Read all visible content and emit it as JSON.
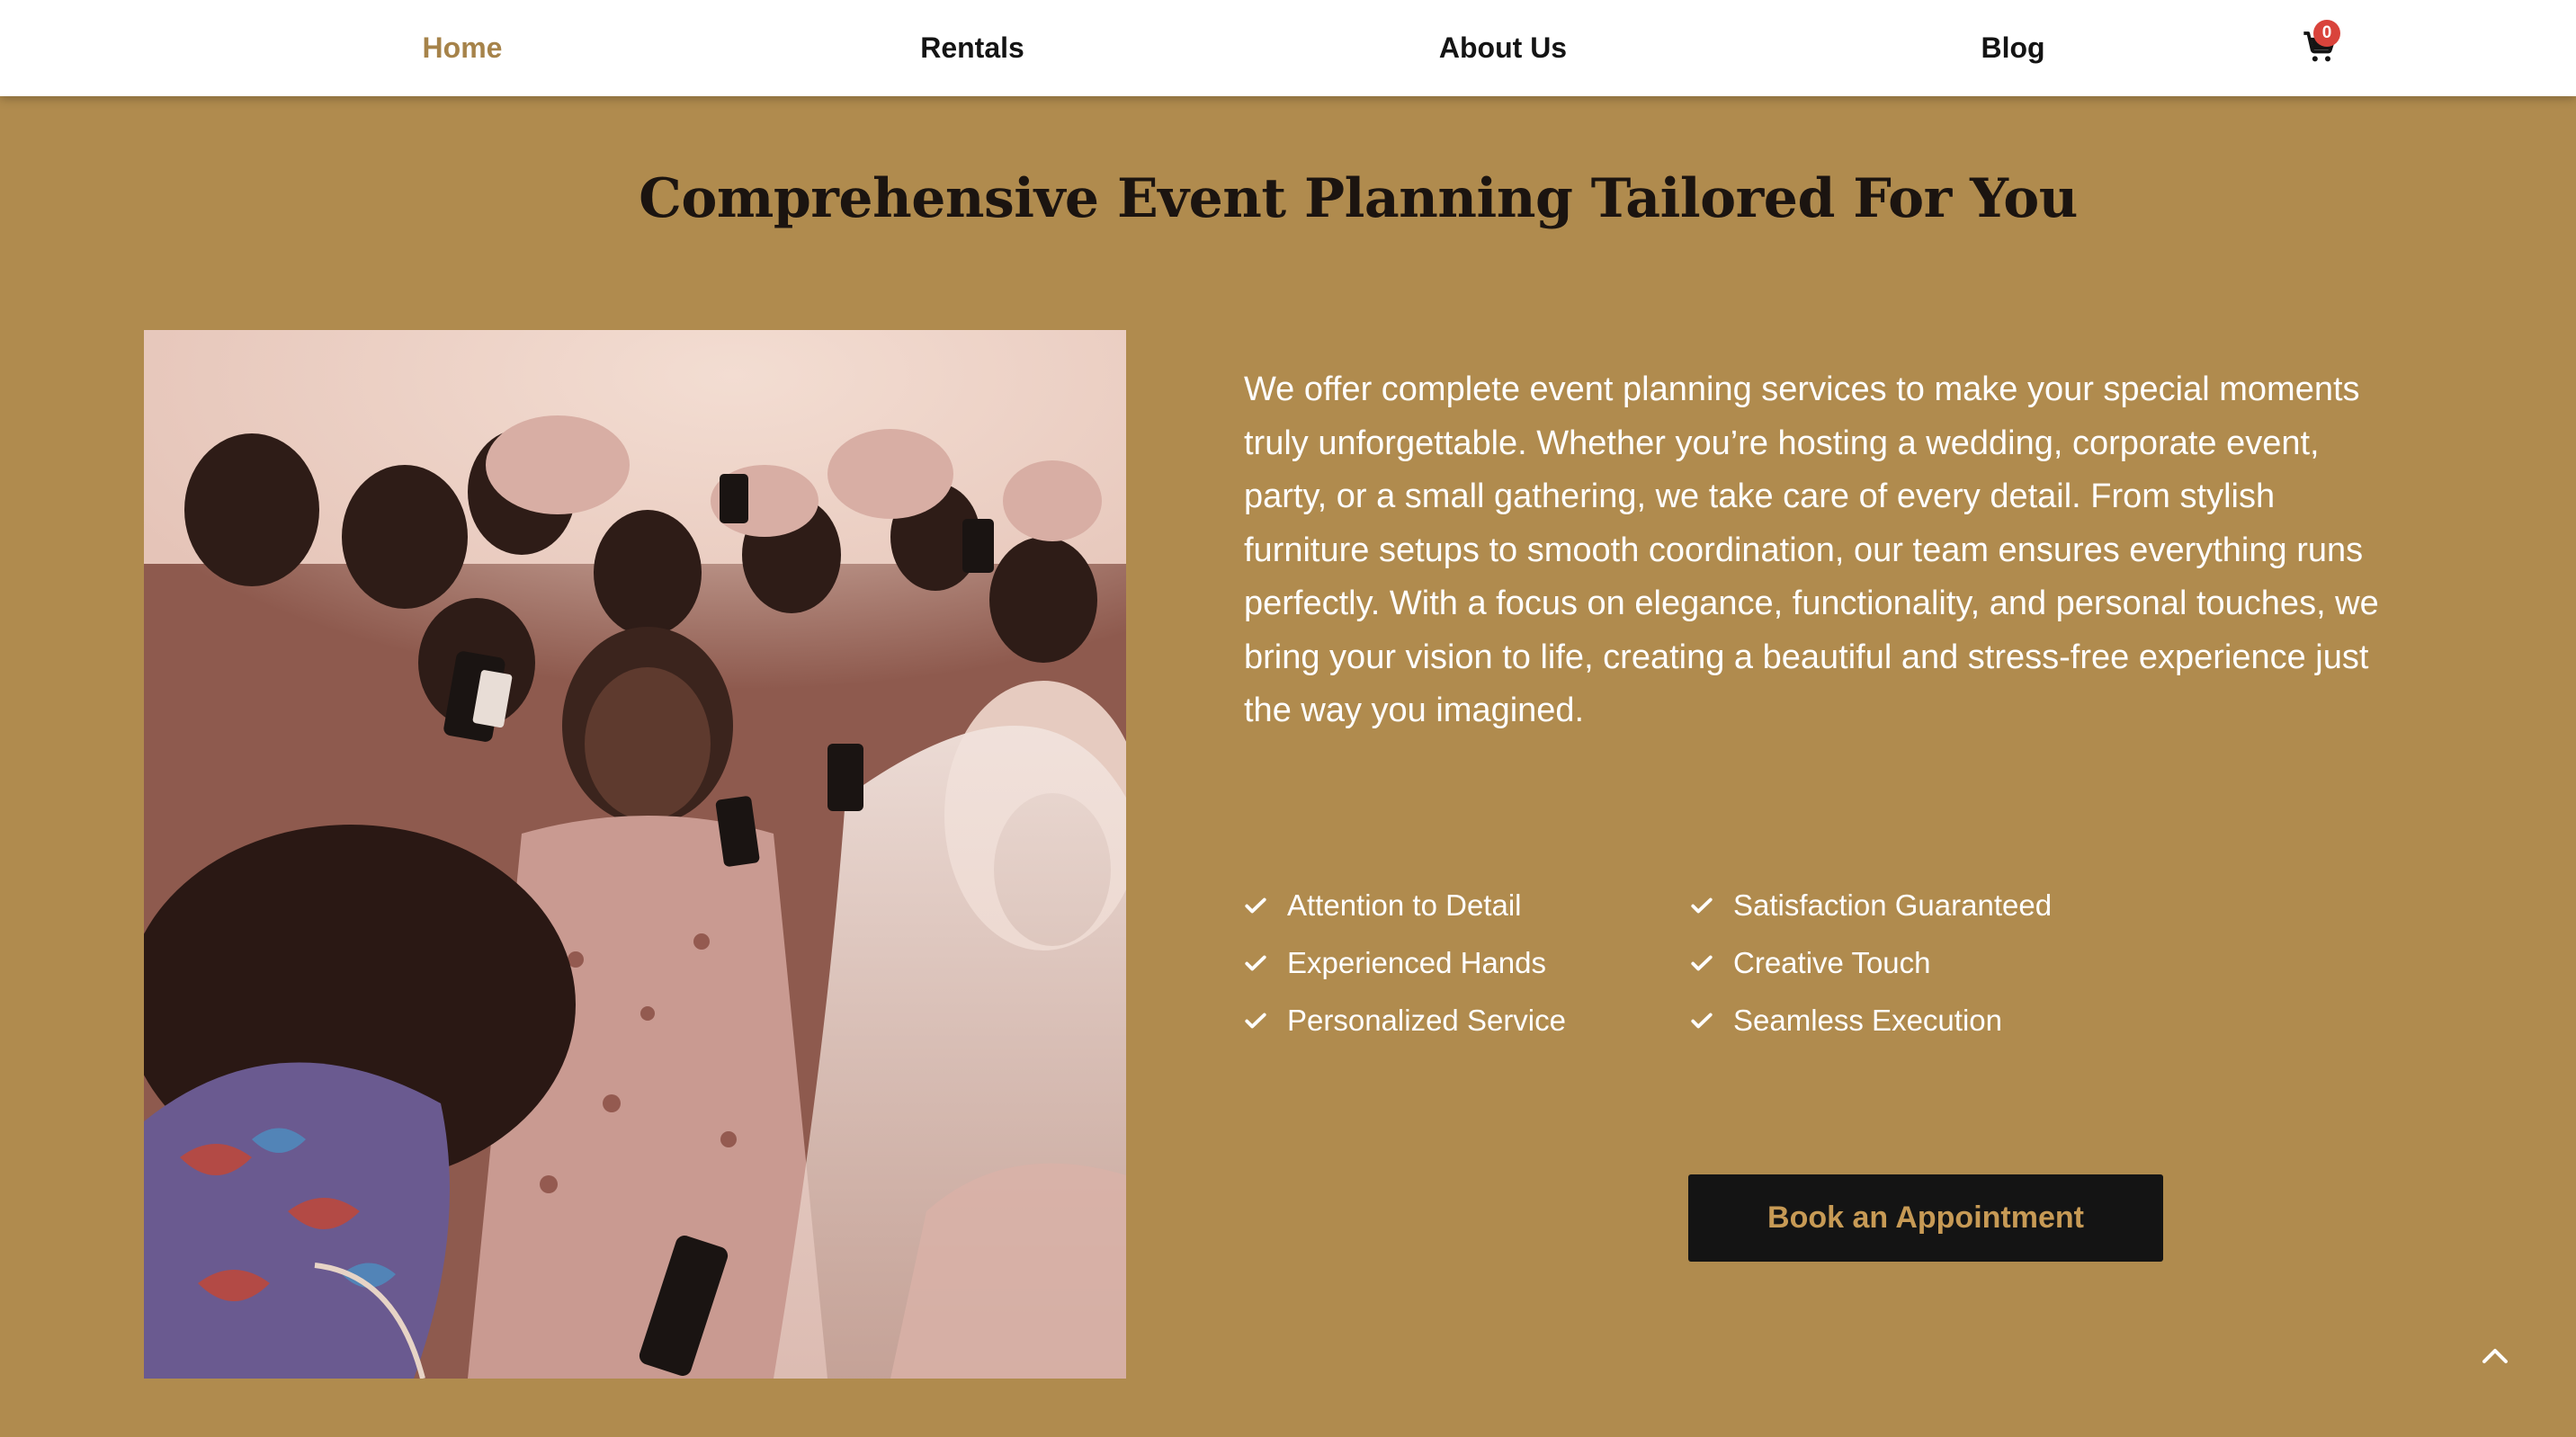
{
  "nav": {
    "items": [
      {
        "label": "Home",
        "active": true
      },
      {
        "label": "Rentals",
        "active": false
      },
      {
        "label": "About Us",
        "active": false
      },
      {
        "label": "Blog",
        "active": false
      }
    ],
    "cart_icon": "shopping-cart-icon",
    "cart_count": "0"
  },
  "section": {
    "title": "Comprehensive Event Planning Tailored For You",
    "image_alt": "Wedding guests celebrating around a bride in a veil",
    "description": "We offer complete event planning services to make your special moments truly unforgettable. Whether you’re hosting a wedding, corporate event, party, or a small gathering, we take care of every detail. From stylish furniture setups to smooth coordination, our team ensures everything runs perfectly. With a focus on elegance, functionality, and personal touches, we bring your vision to life, creating a beautiful and stress-free experience just the way you imagined.",
    "features_left": [
      "Attention to Detail",
      "Experienced Hands",
      "Personalized Service"
    ],
    "features_right": [
      "Satisfaction Guaranteed",
      "Creative Touch",
      "Seamless Execution"
    ],
    "feature_icon": "check-icon",
    "cta_label": "Book an Appointment"
  },
  "scroll_top_icon": "chevron-up-icon",
  "colors": {
    "background": "#b08b4e",
    "nav_active": "#a6834a",
    "button_bg": "#141414",
    "button_text": "#c79a55",
    "badge": "#d9433b"
  }
}
